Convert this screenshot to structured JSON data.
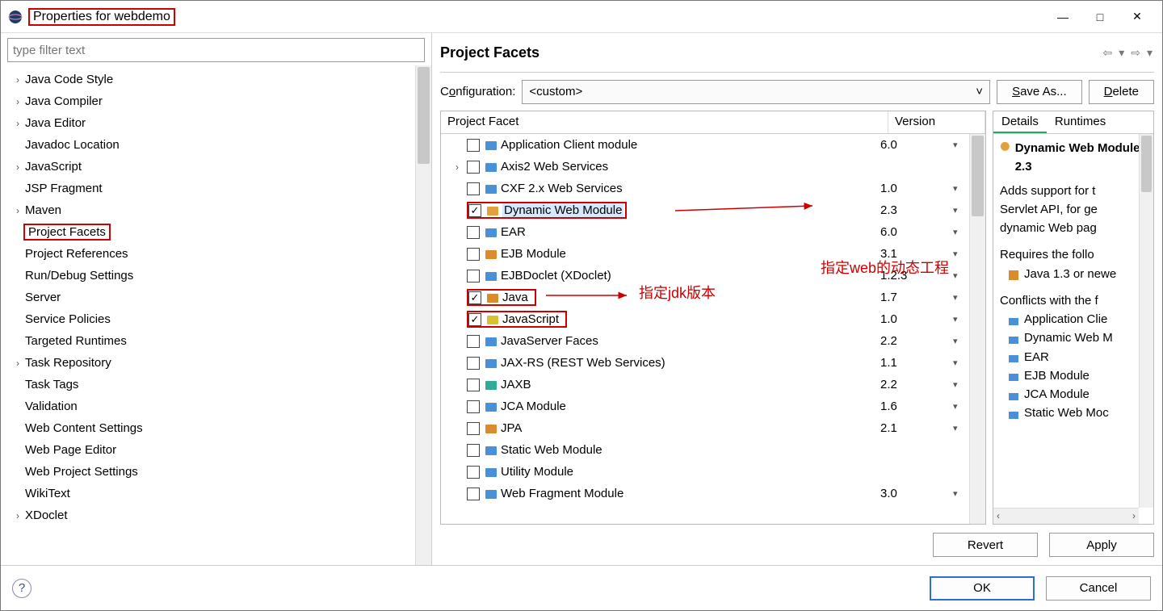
{
  "window": {
    "title": "Properties for webdemo",
    "minimize": "—",
    "maximize": "□",
    "close": "✕"
  },
  "filter_placeholder": "type filter text",
  "tree": [
    {
      "label": "Java Code Style",
      "expandable": true
    },
    {
      "label": "Java Compiler",
      "expandable": true
    },
    {
      "label": "Java Editor",
      "expandable": true
    },
    {
      "label": "Javadoc Location",
      "expandable": false
    },
    {
      "label": "JavaScript",
      "expandable": true
    },
    {
      "label": "JSP Fragment",
      "expandable": false
    },
    {
      "label": "Maven",
      "expandable": true
    },
    {
      "label": "Project Facets",
      "expandable": false,
      "selected": true
    },
    {
      "label": "Project References",
      "expandable": false
    },
    {
      "label": "Run/Debug Settings",
      "expandable": false
    },
    {
      "label": "Server",
      "expandable": false
    },
    {
      "label": "Service Policies",
      "expandable": false
    },
    {
      "label": "Targeted Runtimes",
      "expandable": false
    },
    {
      "label": "Task Repository",
      "expandable": true
    },
    {
      "label": "Task Tags",
      "expandable": false
    },
    {
      "label": "Validation",
      "expandable": false
    },
    {
      "label": "Web Content Settings",
      "expandable": false
    },
    {
      "label": "Web Page Editor",
      "expandable": false
    },
    {
      "label": "Web Project Settings",
      "expandable": false
    },
    {
      "label": "WikiText",
      "expandable": false
    },
    {
      "label": "XDoclet",
      "expandable": true
    }
  ],
  "panel": {
    "title": "Project Facets",
    "config_label_pre": "C",
    "config_label_u": "o",
    "config_label_post": "nfiguration:",
    "config_value": "<custom>",
    "save_as_pre": "",
    "save_as_u": "S",
    "save_as_post": "ave As...",
    "delete_u": "D",
    "delete_post": "elete",
    "col_facet": "Project Facet",
    "col_version": "Version"
  },
  "facets": [
    {
      "name": "Application Client module",
      "version": "6.0",
      "checked": false,
      "icon": "#4a90d9",
      "expandable": false
    },
    {
      "name": "Axis2 Web Services",
      "version": "",
      "checked": false,
      "icon": "#4a90d9",
      "expandable": true
    },
    {
      "name": "CXF 2.x Web Services",
      "version": "1.0",
      "checked": false,
      "icon": "#4a90d9",
      "expandable": false
    },
    {
      "name": "Dynamic Web Module",
      "version": "2.3",
      "checked": true,
      "icon": "#e2a23b",
      "expandable": false,
      "highlight": true,
      "selected": true
    },
    {
      "name": "EAR",
      "version": "6.0",
      "checked": false,
      "icon": "#4a90d9",
      "expandable": false
    },
    {
      "name": "EJB Module",
      "version": "3.1",
      "checked": false,
      "icon": "#d98b2e",
      "expandable": false
    },
    {
      "name": "EJBDoclet (XDoclet)",
      "version": "1.2.3",
      "checked": false,
      "icon": "#4a90d9",
      "expandable": false
    },
    {
      "name": "Java",
      "version": "1.7",
      "checked": true,
      "icon": "#d98b2e",
      "expandable": false,
      "highlight": true
    },
    {
      "name": "JavaScript",
      "version": "1.0",
      "checked": true,
      "icon": "#d9c22e",
      "expandable": false,
      "highlight": true
    },
    {
      "name": "JavaServer Faces",
      "version": "2.2",
      "checked": false,
      "icon": "#4a90d9",
      "expandable": false
    },
    {
      "name": "JAX-RS (REST Web Services)",
      "version": "1.1",
      "checked": false,
      "icon": "#4a90d9",
      "expandable": false
    },
    {
      "name": "JAXB",
      "version": "2.2",
      "checked": false,
      "icon": "#3a9",
      "expandable": false
    },
    {
      "name": "JCA Module",
      "version": "1.6",
      "checked": false,
      "icon": "#4a90d9",
      "expandable": false
    },
    {
      "name": "JPA",
      "version": "2.1",
      "checked": false,
      "icon": "#d98b2e",
      "expandable": false
    },
    {
      "name": "Static Web Module",
      "version": "",
      "checked": false,
      "icon": "#4a90d9",
      "expandable": false
    },
    {
      "name": "Utility Module",
      "version": "",
      "checked": false,
      "icon": "#4a90d9",
      "expandable": false
    },
    {
      "name": "Web Fragment Module",
      "version": "3.0",
      "checked": false,
      "icon": "#4a90d9",
      "expandable": false
    }
  ],
  "details": {
    "tab_details": "Details",
    "tab_runtimes_u": "R",
    "tab_runtimes_post": "untimes",
    "title": "Dynamic Web Module 2.3",
    "desc1": "Adds support for t",
    "desc2": "Servlet API, for ge",
    "desc3": "dynamic Web pag",
    "req_hd": "Requires the follo",
    "req1": "Java 1.3 or newe",
    "conf_hd": "Conflicts with the f",
    "conflicts": [
      "Application Clie",
      "Dynamic Web M",
      "EAR",
      "EJB Module",
      "JCA Module",
      "Static Web Moc"
    ]
  },
  "annotations": {
    "web": "指定web的动态工程",
    "jdk": "指定jdk版本"
  },
  "buttons": {
    "revert": "Revert",
    "apply": "Apply",
    "ok": "OK",
    "cancel": "Cancel"
  }
}
